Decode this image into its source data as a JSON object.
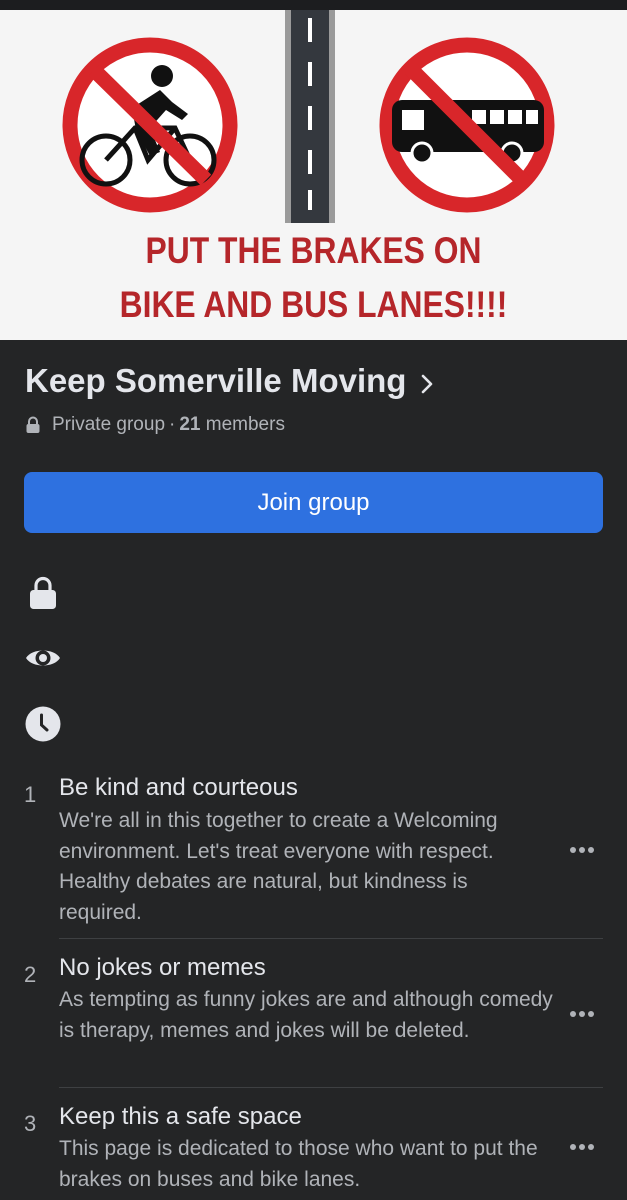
{
  "cover": {
    "line1": "PUT THE BRAKES ON",
    "line2": "BIKE AND BUS LANES!!!!",
    "icons": [
      "no-bike-sign-icon",
      "road-icon",
      "no-bus-sign-icon"
    ],
    "sign_color": "#d8262a",
    "text_color": "#b5262a"
  },
  "group": {
    "name": "Keep Somerville Moving",
    "privacy": "Private group",
    "separator": "·",
    "member_count": "21",
    "members_label": "members"
  },
  "join_button": {
    "label": "Join group",
    "color": "#2e71e0"
  },
  "info_icons": [
    "lock-icon",
    "eye-icon",
    "clock-icon"
  ],
  "rules": [
    {
      "number": "1",
      "title": "Be kind and courteous",
      "description": "We're all in this together to create a Welcoming environment. Let's treat everyone with respect. Healthy debates are natural, but kindness is required."
    },
    {
      "number": "2",
      "title": "No jokes or memes",
      "description": "As tempting as funny jokes are and although comedy is therapy, memes and jokes will be deleted."
    },
    {
      "number": "3",
      "title": "Keep this a safe space",
      "description": "This page is dedicated to those who want to put the brakes on buses and bike lanes."
    }
  ]
}
